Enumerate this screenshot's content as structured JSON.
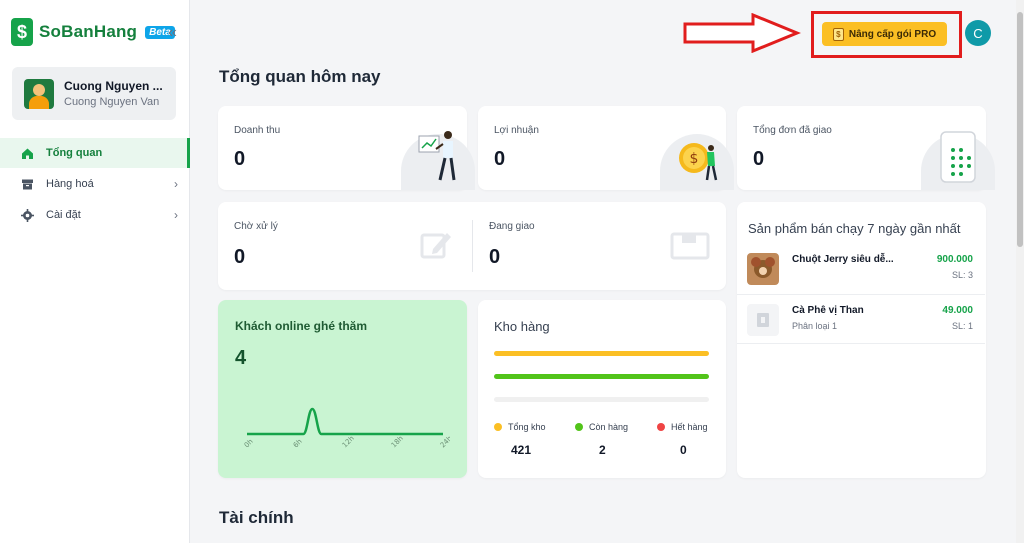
{
  "brand": {
    "name": "SoBanHang",
    "badge": "Beta",
    "logo_glyph": "$",
    "collapse_glyph": "«"
  },
  "user": {
    "name": "Cuong Nguyen ...",
    "subtitle": "Cuong Nguyen Van",
    "initial": "C"
  },
  "nav": [
    {
      "label": "Tổng quan",
      "icon": "home-icon",
      "active": true,
      "has_chevron": false
    },
    {
      "label": "Hàng hoá",
      "icon": "box-icon",
      "active": false,
      "has_chevron": true
    },
    {
      "label": "Cài đặt",
      "icon": "gear-icon",
      "active": false,
      "has_chevron": true
    }
  ],
  "chevron_glyph": "›",
  "upgrade": {
    "label": "Nâng cấp gói PRO",
    "icon_glyph": "$",
    "highlight_color": "#e11d1d"
  },
  "page_title": "Tổng quan hôm nay",
  "stats": {
    "revenue": {
      "label": "Doanh thu",
      "value": "0"
    },
    "profit": {
      "label": "Lợi nhuận",
      "value": "0"
    },
    "delivered": {
      "label": "Tổng đơn đã giao",
      "value": "0"
    },
    "pending": {
      "label": "Chờ xử lý",
      "value": "0"
    },
    "shipping": {
      "label": "Đang giao",
      "value": "0"
    }
  },
  "online": {
    "title": "Khách online ghé thăm",
    "value": "4",
    "ticks": [
      "0h",
      "6h",
      "12h",
      "18h",
      "24h"
    ]
  },
  "chart_data": {
    "type": "line",
    "x": [
      "0h",
      "6h",
      "12h",
      "18h",
      "24h"
    ],
    "series": [
      {
        "values": [
          0,
          0,
          0,
          0,
          0
        ],
        "peak_at_hour": 8,
        "peak_value": 4
      }
    ],
    "title": "Khách online ghé thăm"
  },
  "warehouse": {
    "title": "Kho hàng",
    "bars": [
      {
        "color": "#fbbf24",
        "fraction": 1.0
      },
      {
        "color": "#52c41a",
        "fraction": 1.0
      },
      {
        "color": "#f0f0f0",
        "fraction": 1.0
      }
    ],
    "legend": [
      {
        "label": "Tổng kho",
        "value": "421",
        "color": "#fbbf24"
      },
      {
        "label": "Còn hàng",
        "value": "2",
        "color": "#52c41a"
      },
      {
        "label": "Hết hàng",
        "value": "0",
        "color": "#ef4444"
      }
    ]
  },
  "bestsellers": {
    "title": "Sản phẩm bán chạy 7 ngày gần nhất",
    "items": [
      {
        "name": "Chuột Jerry siêu dễ...",
        "sub": "",
        "price": "900.000",
        "qty": "SL: 3"
      },
      {
        "name": "Cà Phê vị Than",
        "sub": "Phân loại 1",
        "price": "49.000",
        "qty": "SL: 1"
      }
    ]
  },
  "finance_title": "Tài chính",
  "colors": {
    "brand_green": "#16a34a",
    "online_bg": "#c9f4d2",
    "pro_yellow": "#fbbf24"
  }
}
